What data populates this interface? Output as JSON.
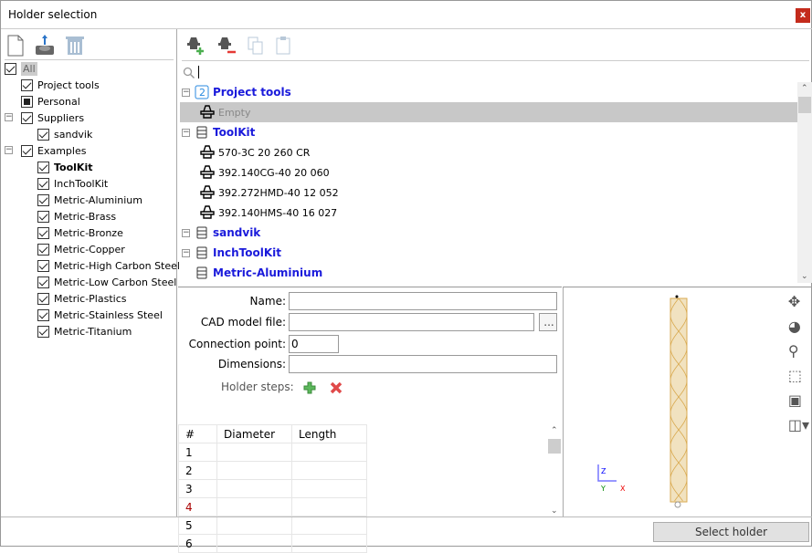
{
  "window": {
    "title": "Holder selection",
    "close": "x"
  },
  "left_tree": {
    "items": [
      {
        "label": "All",
        "state": "checked",
        "bold": false
      },
      {
        "label": "Project tools",
        "state": "checked"
      },
      {
        "label": "Personal",
        "state": "partial"
      },
      {
        "label": "Suppliers",
        "state": "checked"
      },
      {
        "label": "sandvik",
        "state": "checked"
      },
      {
        "label": "Examples",
        "state": "checked"
      },
      {
        "label": "ToolKit",
        "state": "checked",
        "bold": true
      },
      {
        "label": "InchToolKit",
        "state": "checked"
      },
      {
        "label": "Metric-Aluminium",
        "state": "checked"
      },
      {
        "label": "Metric-Brass",
        "state": "checked"
      },
      {
        "label": "Metric-Bronze",
        "state": "checked"
      },
      {
        "label": "Metric-Copper",
        "state": "checked"
      },
      {
        "label": "Metric-High Carbon Steel",
        "state": "checked"
      },
      {
        "label": "Metric-Low Carbon Steel",
        "state": "checked"
      },
      {
        "label": "Metric-Plastics",
        "state": "checked"
      },
      {
        "label": "Metric-Stainless Steel",
        "state": "checked"
      },
      {
        "label": "Metric-Titanium",
        "state": "checked"
      }
    ]
  },
  "search": {
    "value": ""
  },
  "holder_tree": {
    "items": [
      {
        "label": "Project tools",
        "type": "group",
        "icon": "project-icon"
      },
      {
        "label": "Empty",
        "type": "empty",
        "selected": true
      },
      {
        "label": "ToolKit",
        "type": "group"
      },
      {
        "label": "570-3C 20 260 CR",
        "type": "holder"
      },
      {
        "label": "392.140CG-40 20 060",
        "type": "holder"
      },
      {
        "label": "392.272HMD-40 12 052",
        "type": "holder"
      },
      {
        "label": "392.140HMS-40 16 027",
        "type": "holder"
      },
      {
        "label": "sandvik",
        "type": "group"
      },
      {
        "label": "InchToolKit",
        "type": "group"
      },
      {
        "label": "Metric-Aluminium",
        "type": "group"
      }
    ]
  },
  "form": {
    "name_label": "Name:",
    "name_value": "",
    "cad_label": "CAD model file:",
    "cad_value": "",
    "browse": "...",
    "conn_label": "Connection point:",
    "conn_value": "0",
    "dim_label": "Dimensions:",
    "dim_value": "",
    "steps_label": "Holder steps:"
  },
  "steps_table": {
    "headers": [
      "#",
      "Diameter",
      "Length"
    ],
    "rows": [
      "1",
      "2",
      "3",
      "4",
      "5",
      "6"
    ]
  },
  "viewer": {
    "axis_z": "Z",
    "axis_y": "Y",
    "axis_x": "X"
  },
  "footer": {
    "select": "Select holder"
  }
}
